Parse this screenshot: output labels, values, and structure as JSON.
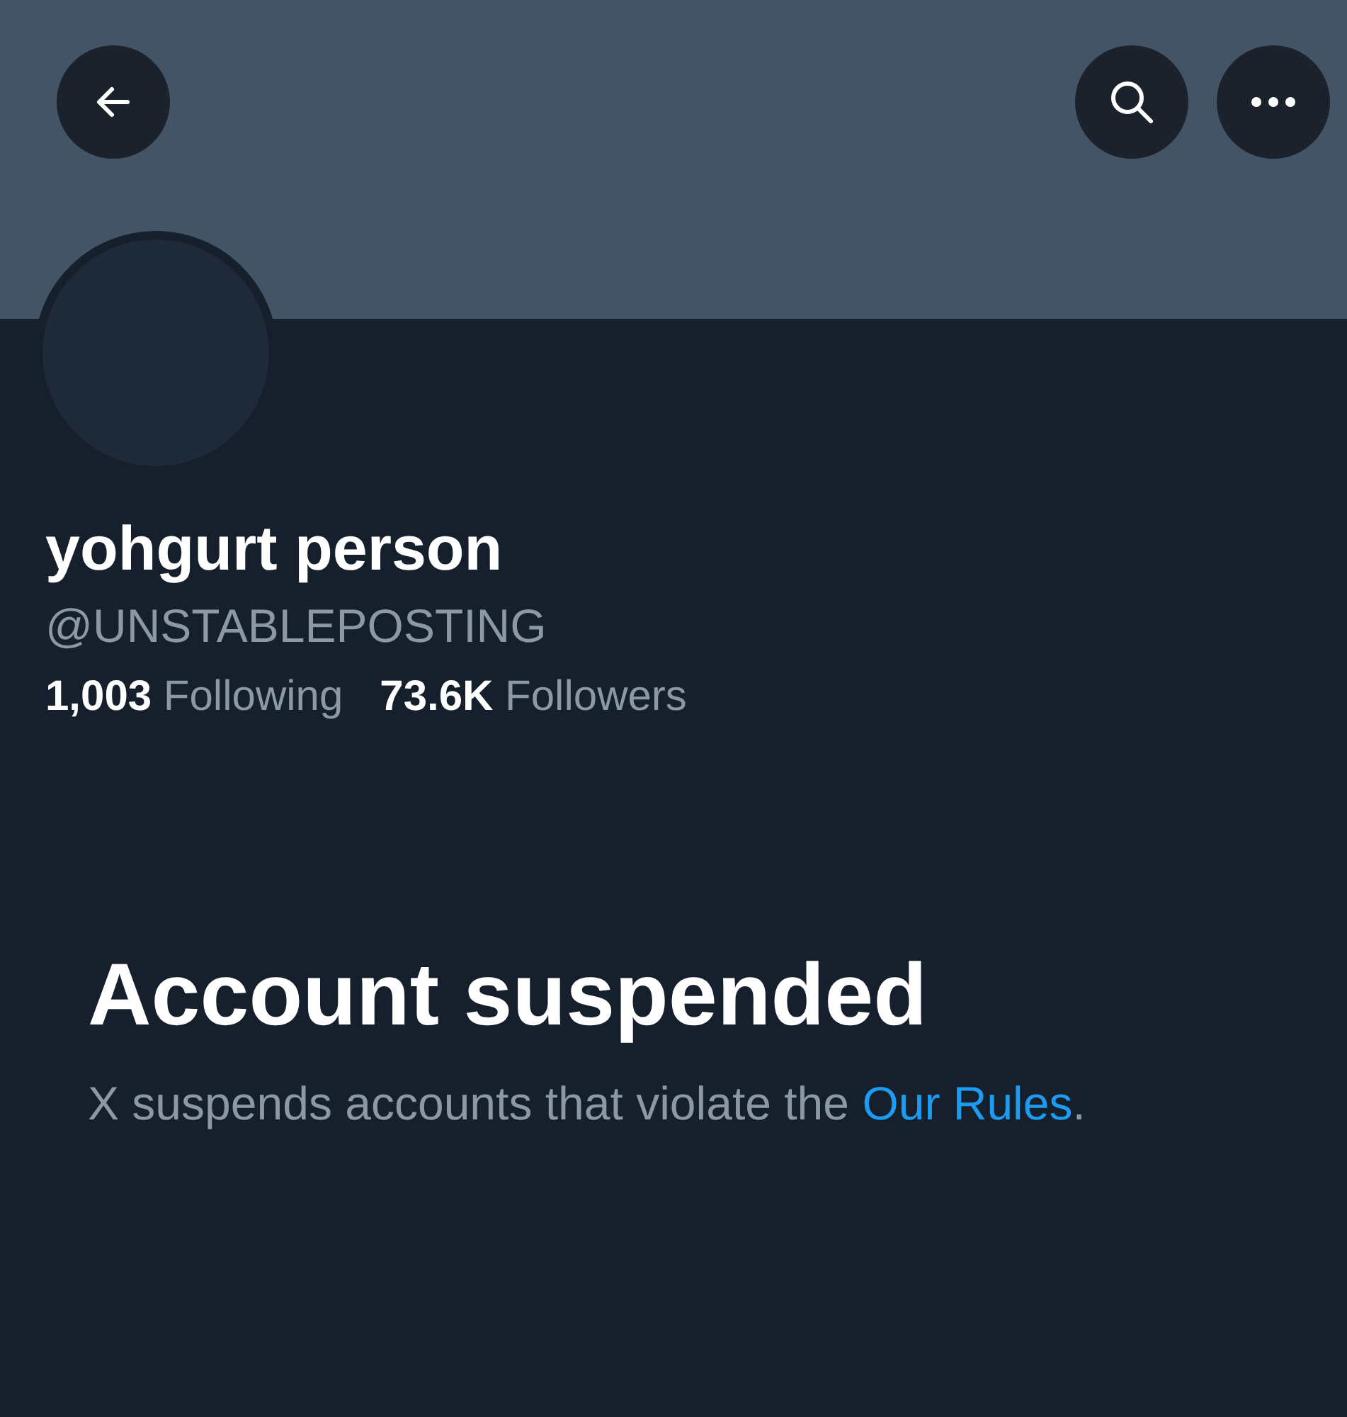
{
  "profile": {
    "name": "yohgurt person",
    "handle": "@UNSTABLEPOSTING",
    "stats": [
      {
        "count": "1,003",
        "label": "Following"
      },
      {
        "count": "73.6K",
        "label": "Followers"
      }
    ]
  },
  "notice": {
    "title": "Account suspended",
    "text_before": "X suspends accounts that violate the ",
    "link": "Our Rules",
    "text_after": "."
  }
}
